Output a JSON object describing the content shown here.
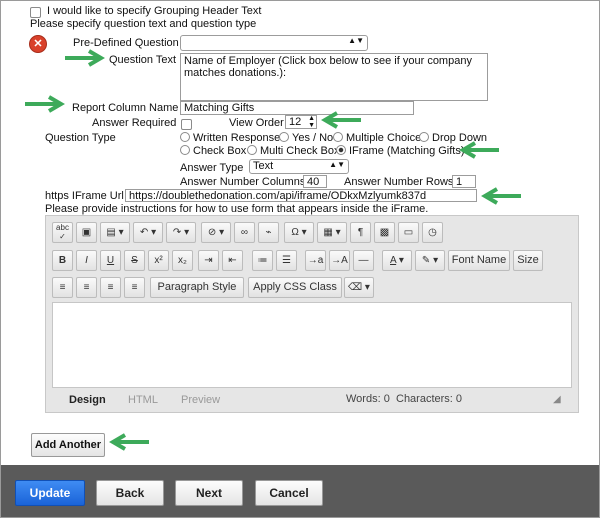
{
  "header": {
    "grouping_checkbox_label": "I would like to specify Grouping Header Text",
    "specify_text": "Please specify question text and question type"
  },
  "form": {
    "predefined_label": "Pre-Defined Question",
    "predefined_value": "",
    "question_text_label": "Question Text",
    "question_text_value": "Name of Employer (Click box below to see if your company matches donations.):",
    "report_column_label": "Report Column Name",
    "report_column_value": "Matching Gifts",
    "answer_required_label": "Answer Required",
    "view_order_label": "View Order",
    "view_order_value": "12",
    "question_type_label": "Question Type",
    "types": [
      "Written Response",
      "Yes / No",
      "Multiple Choice",
      "Drop Down",
      "Check Box",
      "Multi Check Box",
      "IFrame (Matching Gifts)"
    ],
    "selected_type": "IFrame (Matching Gifts)",
    "answer_type_label": "Answer Type",
    "answer_type_value": "Text",
    "answer_columns_label": "Answer Number Columns",
    "answer_columns_value": "40",
    "answer_rows_label": "Answer Number Rows",
    "answer_rows_value": "1",
    "iframe_url_label": "https IFrame Url",
    "iframe_url_value": "https://doublethedonation.com/api/iframe/ODkxMzlyumk837d",
    "instructions_text": "Please provide instructions for how to use form that appears inside the iFrame."
  },
  "editor": {
    "font_name": "Font Name",
    "size": "Size",
    "paragraph_style": "Paragraph Style",
    "apply_css": "Apply CSS Class",
    "tabs": [
      "Design",
      "HTML",
      "Preview"
    ],
    "words": "Words: 0",
    "characters": "Characters: 0"
  },
  "add_another": "Add Another",
  "footer": {
    "update": "Update",
    "back": "Back",
    "next": "Next",
    "cancel": "Cancel"
  },
  "colors": {
    "arrow": "#3daa5a",
    "primary": "#1f6fe0",
    "footer_bar": "#5a5a5a",
    "delete_icon": "#d9412b"
  }
}
